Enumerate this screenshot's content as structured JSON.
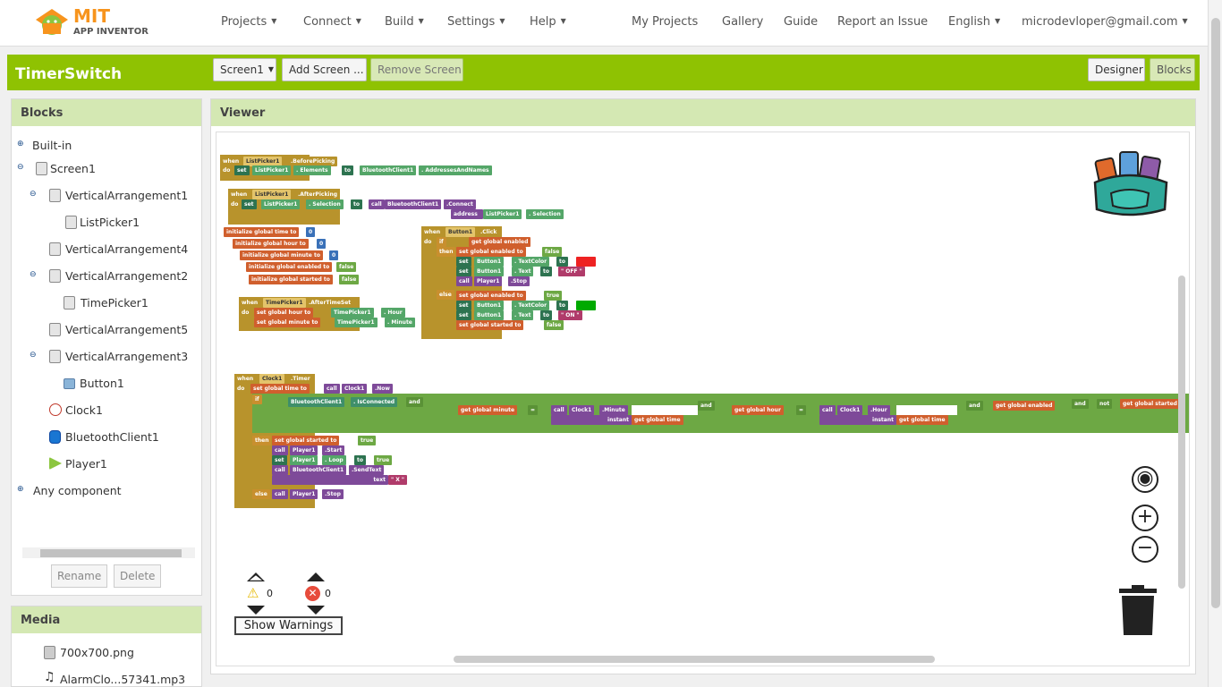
{
  "nav": {
    "logo_mit": "MIT",
    "logo_ai": "APP INVENTOR",
    "left": [
      "Projects",
      "Connect",
      "Build",
      "Settings",
      "Help"
    ],
    "right": [
      "My Projects",
      "Gallery",
      "Guide",
      "Report an Issue",
      "English",
      "microdevloper@gmail.com"
    ]
  },
  "project": {
    "name": "TimerSwitch",
    "screen_select": "Screen1",
    "add_screen": "Add Screen ...",
    "remove_screen": "Remove Screen",
    "designer": "Designer",
    "blocks": "Blocks"
  },
  "blocks_panel": {
    "title": "Blocks",
    "items": [
      "Built-in",
      "Screen1",
      "VerticalArrangement1",
      "ListPicker1",
      "VerticalArrangement4",
      "VerticalArrangement2",
      "TimePicker1",
      "VerticalArrangement5",
      "VerticalArrangement3",
      "Button1",
      "Clock1",
      "BluetoothClient1",
      "Player1",
      "Any component"
    ],
    "rename": "Rename",
    "delete": "Delete"
  },
  "media": {
    "title": "Media",
    "files": [
      "700x700.png",
      "AlarmClo...57341.mp3"
    ]
  },
  "viewer": {
    "title": "Viewer",
    "warn_count": "0",
    "error_count": "0",
    "show_warnings": "Show Warnings"
  },
  "code": {
    "b1": [
      "when",
      "ListPicker1",
      ".BeforePicking",
      "do",
      "set",
      "ListPicker1",
      ". Elements",
      "to",
      "BluetoothClient1",
      ". AddressesAndNames"
    ],
    "b2": [
      "when",
      "ListPicker1",
      ".AfterPicking",
      "do",
      "set",
      "ListPicker1",
      ". Selection",
      "to",
      "call",
      "BluetoothClient1",
      ".Connect",
      "address",
      "ListPicker1",
      ". Selection"
    ],
    "inits": [
      "initialize global time to",
      "0",
      "initialize global hour to",
      "0",
      "initialize global minute to",
      "0",
      "initialize global enabled to",
      "false",
      "initialize global started to",
      "false"
    ],
    "b3": [
      "when",
      "TimePicker1",
      ".AfterTimeSet",
      "do",
      "set global hour to",
      "TimePicker1",
      ". Hour",
      "set global minute to",
      "TimePicker1",
      ". Minute"
    ],
    "b4": [
      "when",
      "Button1",
      ".Click",
      "do",
      "if",
      "get global enabled",
      "then",
      "set global enabled to",
      "false",
      "set",
      "Button1",
      ". TextColor",
      "to",
      "set",
      "Button1",
      ". Text",
      "to",
      "\" OFF \"",
      "call",
      "Player1",
      ".Stop",
      "else",
      "set global enabled to",
      "true",
      "set",
      "Button1",
      ". TextColor",
      "to",
      "set",
      "Button1",
      ". Text",
      "to",
      "\" ON \"",
      "set global started to",
      "false"
    ],
    "b5": [
      "when",
      "Clock1",
      ".Timer",
      "do",
      "set global time to",
      "call",
      "Clock1",
      ".Now",
      "if",
      "BluetoothClient1",
      ". IsConnected",
      "and",
      "get global minute",
      "=",
      "call",
      "Clock1",
      ".Minute",
      "instant",
      "get global time",
      "and",
      "get global hour",
      "=",
      "call",
      "Clock1",
      ".Hour",
      "instant",
      "get global time",
      "and",
      "get global enabled",
      "and",
      "not",
      "get global started",
      "then",
      "set global started to",
      "true",
      "call",
      "Player1",
      ".Start",
      "set",
      "Player1",
      ". Loop",
      "to",
      "true",
      "call",
      "BluetoothClient1",
      ".SendText",
      "text",
      "\" X \"",
      "else",
      "call",
      "Player1",
      ".Stop"
    ]
  },
  "colors": {
    "green_bar": "#8fc202",
    "panel_head": "#d4e8b3",
    "event": "#b8932c",
    "set": "#d05f2d",
    "call": "#7e4a99"
  }
}
